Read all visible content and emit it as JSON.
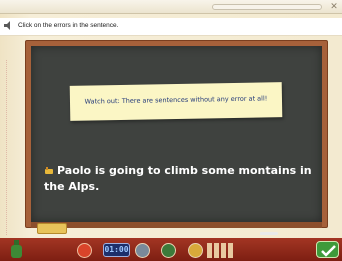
{
  "instruction": "Click on the errors in the sentence.",
  "note": "Watch out: There are sentences without any error at all!",
  "sentence": "Paolo is going to climb some montains in the Alps.",
  "toolbar": {
    "timer": "01:00"
  },
  "colors": {
    "board": "#3f423f",
    "frame": "#a6613a",
    "note": "#fbf6c5",
    "toolbar": "#8f2a1a"
  }
}
